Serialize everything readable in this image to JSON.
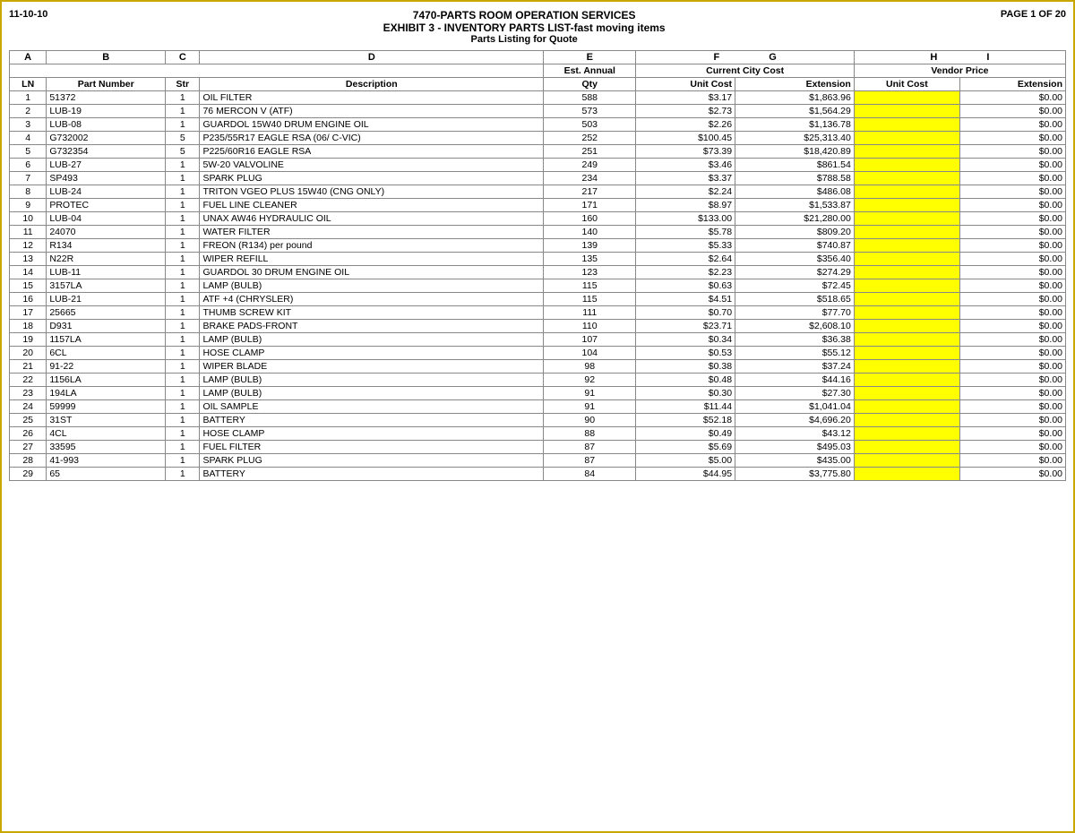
{
  "header": {
    "date": "11-10-10",
    "title1": "7470-PARTS ROOM OPERATION SERVICES",
    "title2": "EXHIBIT 3 - INVENTORY PARTS LIST-fast moving items",
    "title3": "Parts Listing for Quote",
    "page": "PAGE 1 OF 20"
  },
  "columns": {
    "a": "A",
    "b": "B",
    "c": "C",
    "d": "D",
    "e": "E",
    "f": "F",
    "g": "G",
    "h": "H",
    "i": "I",
    "est_annual": "Est. Annual",
    "current_city_cost": "Current City Cost",
    "vendor_price": "Vendor Price",
    "ln": "LN",
    "part_number": "Part Number",
    "str": "Str",
    "description": "Description",
    "qty": "Qty",
    "unit_cost": "Unit Cost",
    "extension": "Extension",
    "unit_cost2": "Unit Cost",
    "extension2": "Extension"
  },
  "rows": [
    {
      "ln": 1,
      "part": "51372",
      "str": 1,
      "desc": "OIL FILTER",
      "qty": 588,
      "unit_cost": "$3.17",
      "extension": "$1,863.96",
      "vendor_ext": "$0.00"
    },
    {
      "ln": 2,
      "part": "LUB-19",
      "str": 1,
      "desc": "76 MERCON V (ATF)",
      "qty": 573,
      "unit_cost": "$2.73",
      "extension": "$1,564.29",
      "vendor_ext": "$0.00"
    },
    {
      "ln": 3,
      "part": "LUB-08",
      "str": 1,
      "desc": "GUARDOL 15W40 DRUM ENGINE OIL",
      "qty": 503,
      "unit_cost": "$2.26",
      "extension": "$1,136.78",
      "vendor_ext": "$0.00"
    },
    {
      "ln": 4,
      "part": "G732002",
      "str": 5,
      "desc": "P235/55R17 EAGLE RSA (06/ C-VIC)",
      "qty": 252,
      "unit_cost": "$100.45",
      "extension": "$25,313.40",
      "vendor_ext": "$0.00"
    },
    {
      "ln": 5,
      "part": "G732354",
      "str": 5,
      "desc": "P225/60R16 EAGLE RSA",
      "qty": 251,
      "unit_cost": "$73.39",
      "extension": "$18,420.89",
      "vendor_ext": "$0.00"
    },
    {
      "ln": 6,
      "part": "LUB-27",
      "str": 1,
      "desc": "5W-20 VALVOLINE",
      "qty": 249,
      "unit_cost": "$3.46",
      "extension": "$861.54",
      "vendor_ext": "$0.00"
    },
    {
      "ln": 7,
      "part": "SP493",
      "str": 1,
      "desc": "SPARK PLUG",
      "qty": 234,
      "unit_cost": "$3.37",
      "extension": "$788.58",
      "vendor_ext": "$0.00"
    },
    {
      "ln": 8,
      "part": "LUB-24",
      "str": 1,
      "desc": "TRITON VGEO PLUS 15W40 (CNG ONLY)",
      "qty": 217,
      "unit_cost": "$2.24",
      "extension": "$486.08",
      "vendor_ext": "$0.00"
    },
    {
      "ln": 9,
      "part": "PROTEC",
      "str": 1,
      "desc": "FUEL LINE CLEANER",
      "qty": 171,
      "unit_cost": "$8.97",
      "extension": "$1,533.87",
      "vendor_ext": "$0.00"
    },
    {
      "ln": 10,
      "part": "LUB-04",
      "str": 1,
      "desc": "UNAX AW46 HYDRAULIC OIL",
      "qty": 160,
      "unit_cost": "$133.00",
      "extension": "$21,280.00",
      "vendor_ext": "$0.00"
    },
    {
      "ln": 11,
      "part": "24070",
      "str": 1,
      "desc": "WATER FILTER",
      "qty": 140,
      "unit_cost": "$5.78",
      "extension": "$809.20",
      "vendor_ext": "$0.00"
    },
    {
      "ln": 12,
      "part": "R134",
      "str": 1,
      "desc": "FREON (R134) per pound",
      "qty": 139,
      "unit_cost": "$5.33",
      "extension": "$740.87",
      "vendor_ext": "$0.00"
    },
    {
      "ln": 13,
      "part": "N22R",
      "str": 1,
      "desc": "WIPER REFILL",
      "qty": 135,
      "unit_cost": "$2.64",
      "extension": "$356.40",
      "vendor_ext": "$0.00"
    },
    {
      "ln": 14,
      "part": "LUB-11",
      "str": 1,
      "desc": "GUARDOL 30 DRUM ENGINE OIL",
      "qty": 123,
      "unit_cost": "$2.23",
      "extension": "$274.29",
      "vendor_ext": "$0.00"
    },
    {
      "ln": 15,
      "part": "3157LA",
      "str": 1,
      "desc": "LAMP (BULB)",
      "qty": 115,
      "unit_cost": "$0.63",
      "extension": "$72.45",
      "vendor_ext": "$0.00"
    },
    {
      "ln": 16,
      "part": "LUB-21",
      "str": 1,
      "desc": "ATF +4 (CHRYSLER)",
      "qty": 115,
      "unit_cost": "$4.51",
      "extension": "$518.65",
      "vendor_ext": "$0.00"
    },
    {
      "ln": 17,
      "part": "25665",
      "str": 1,
      "desc": "THUMB SCREW KIT",
      "qty": 111,
      "unit_cost": "$0.70",
      "extension": "$77.70",
      "vendor_ext": "$0.00"
    },
    {
      "ln": 18,
      "part": "D931",
      "str": 1,
      "desc": "BRAKE PADS-FRONT",
      "qty": 110,
      "unit_cost": "$23.71",
      "extension": "$2,608.10",
      "vendor_ext": "$0.00"
    },
    {
      "ln": 19,
      "part": "1157LA",
      "str": 1,
      "desc": "LAMP (BULB)",
      "qty": 107,
      "unit_cost": "$0.34",
      "extension": "$36.38",
      "vendor_ext": "$0.00"
    },
    {
      "ln": 20,
      "part": "6CL",
      "str": 1,
      "desc": "HOSE CLAMP",
      "qty": 104,
      "unit_cost": "$0.53",
      "extension": "$55.12",
      "vendor_ext": "$0.00"
    },
    {
      "ln": 21,
      "part": "91-22",
      "str": 1,
      "desc": "WIPER BLADE",
      "qty": 98,
      "unit_cost": "$0.38",
      "extension": "$37.24",
      "vendor_ext": "$0.00"
    },
    {
      "ln": 22,
      "part": "1156LA",
      "str": 1,
      "desc": "LAMP (BULB)",
      "qty": 92,
      "unit_cost": "$0.48",
      "extension": "$44.16",
      "vendor_ext": "$0.00"
    },
    {
      "ln": 23,
      "part": "194LA",
      "str": 1,
      "desc": "LAMP (BULB)",
      "qty": 91,
      "unit_cost": "$0.30",
      "extension": "$27.30",
      "vendor_ext": "$0.00"
    },
    {
      "ln": 24,
      "part": "59999",
      "str": 1,
      "desc": "OIL SAMPLE",
      "qty": 91,
      "unit_cost": "$11.44",
      "extension": "$1,041.04",
      "vendor_ext": "$0.00"
    },
    {
      "ln": 25,
      "part": "31ST",
      "str": 1,
      "desc": "BATTERY",
      "qty": 90,
      "unit_cost": "$52.18",
      "extension": "$4,696.20",
      "vendor_ext": "$0.00"
    },
    {
      "ln": 26,
      "part": "4CL",
      "str": 1,
      "desc": "HOSE CLAMP",
      "qty": 88,
      "unit_cost": "$0.49",
      "extension": "$43.12",
      "vendor_ext": "$0.00"
    },
    {
      "ln": 27,
      "part": "33595",
      "str": 1,
      "desc": "FUEL FILTER",
      "qty": 87,
      "unit_cost": "$5.69",
      "extension": "$495.03",
      "vendor_ext": "$0.00"
    },
    {
      "ln": 28,
      "part": "41-993",
      "str": 1,
      "desc": "SPARK PLUG",
      "qty": 87,
      "unit_cost": "$5.00",
      "extension": "$435.00",
      "vendor_ext": "$0.00"
    },
    {
      "ln": 29,
      "part": "65",
      "str": 1,
      "desc": "BATTERY",
      "qty": 84,
      "unit_cost": "$44.95",
      "extension": "$3,775.80",
      "vendor_ext": "$0.00"
    }
  ]
}
